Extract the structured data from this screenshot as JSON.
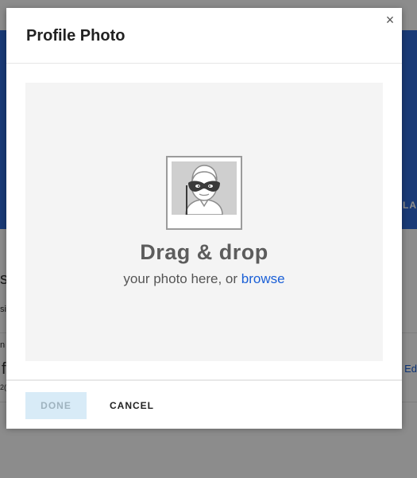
{
  "background": {
    "right_label": "LA",
    "link_text": "Ed",
    "left_fragments": [
      "s",
      "si",
      "n",
      "f",
      "2("
    ]
  },
  "modal": {
    "title": "Profile Photo",
    "close_glyph": "×",
    "dropzone": {
      "title": "Drag & drop",
      "subtitle_prefix": "your photo here, or ",
      "browse_label": "browse"
    },
    "footer": {
      "done_label": "DONE",
      "cancel_label": "CANCEL"
    }
  },
  "colors": {
    "accent": "#1a5fd6",
    "banner": "#2e6bd9",
    "done_bg": "#d8ebf7"
  }
}
